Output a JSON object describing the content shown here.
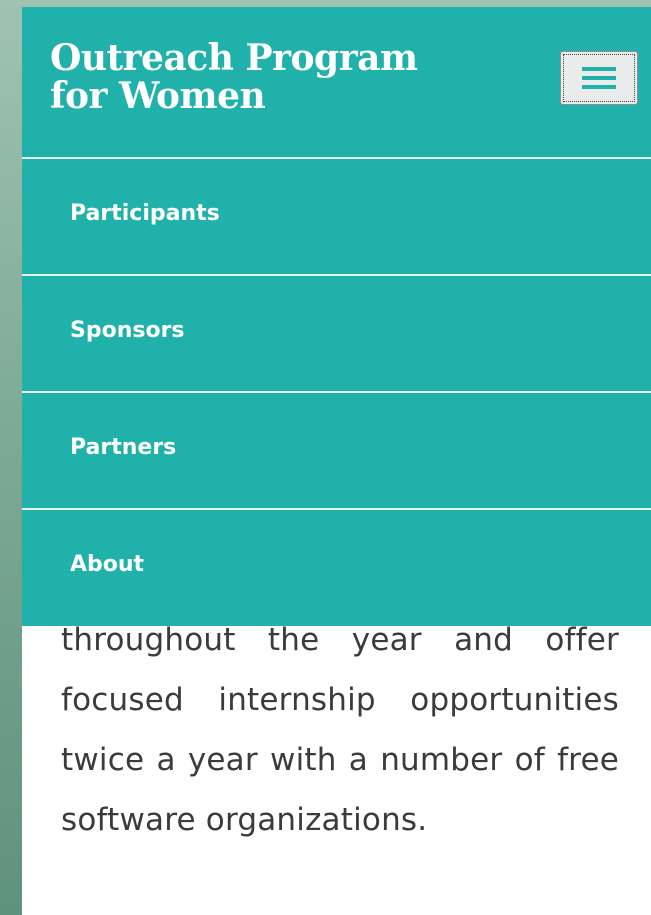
{
  "header": {
    "brand_line1": "Outreach Program",
    "brand_line2": "for Women",
    "menu_toggle_icon": "hamburger-icon"
  },
  "nav": {
    "items": [
      {
        "label": "Participants"
      },
      {
        "label": "Sponsors"
      },
      {
        "label": "Partners"
      },
      {
        "label": "About"
      }
    ]
  },
  "content": {
    "paragraph": "throughout the year and offer focused internship opportunities twice a year with a number of free software organizations."
  },
  "colors": {
    "accent": "#20b2aa",
    "text": "#3b3b3b"
  }
}
